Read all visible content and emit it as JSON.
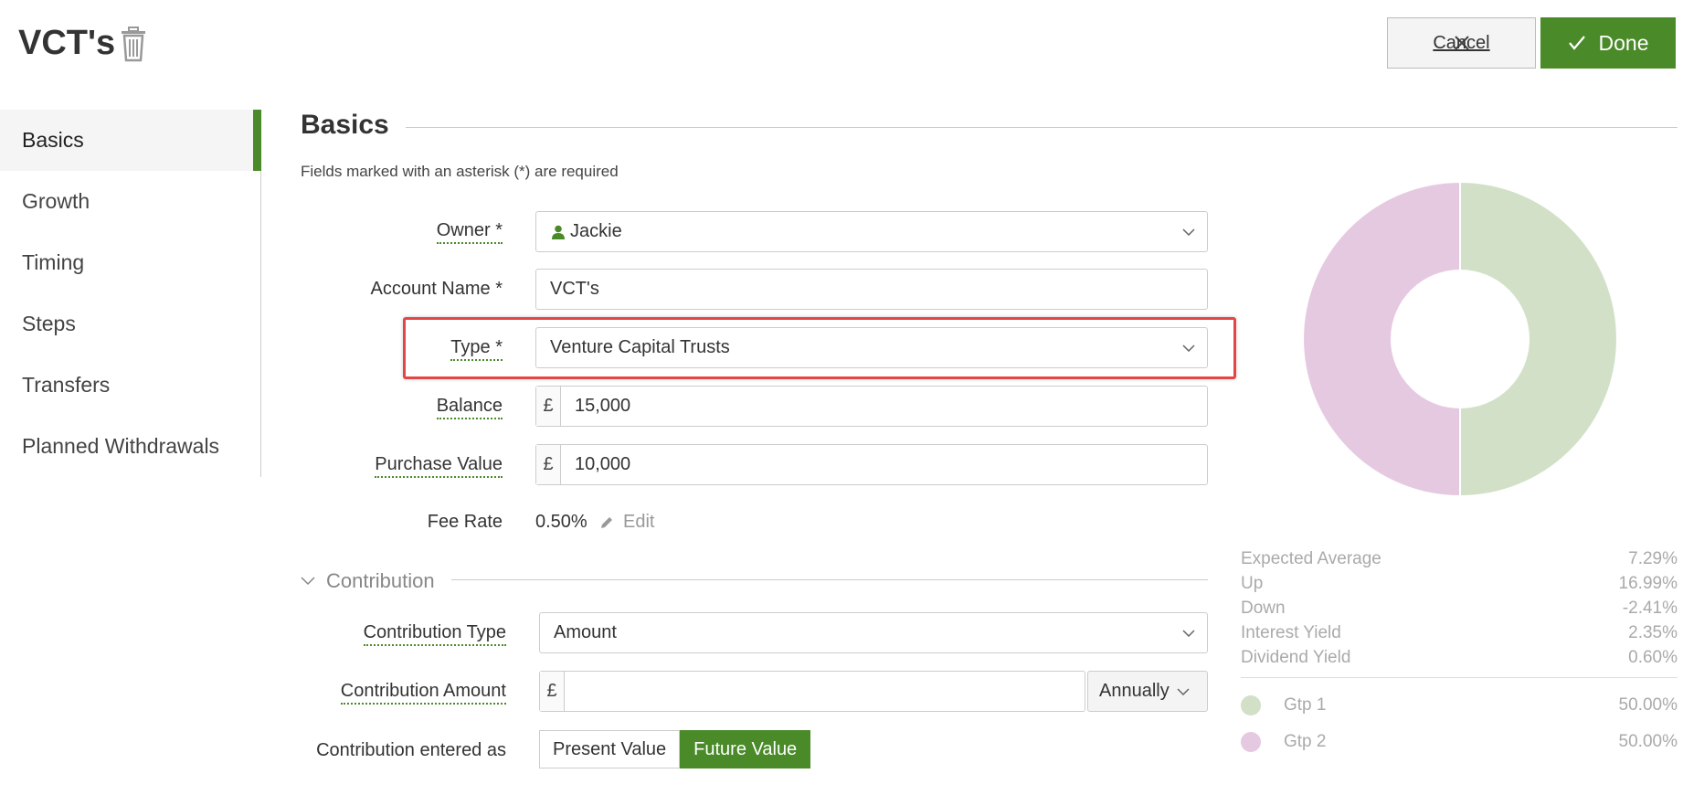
{
  "page": {
    "title": "VCT's",
    "cancel_label": "Cancel",
    "done_label": "Done"
  },
  "sidebar": {
    "items": [
      {
        "label": "Basics",
        "active": true
      },
      {
        "label": "Growth"
      },
      {
        "label": "Timing"
      },
      {
        "label": "Steps"
      },
      {
        "label": "Transfers"
      },
      {
        "label": "Planned Withdrawals"
      }
    ]
  },
  "basics": {
    "section_title": "Basics",
    "required_note": "Fields marked with an asterisk (*) are required",
    "owner": {
      "label": "Owner *",
      "value": "Jackie"
    },
    "account_name": {
      "label": "Account Name *",
      "value": "VCT's"
    },
    "type": {
      "label": "Type *",
      "value": "Venture Capital Trusts"
    },
    "balance": {
      "label": "Balance",
      "currency": "£",
      "value": "15,000"
    },
    "purchase_value": {
      "label": "Purchase Value",
      "currency": "£",
      "value": "10,000"
    },
    "fee_rate": {
      "label": "Fee Rate",
      "value": "0.50%",
      "edit_label": "Edit"
    }
  },
  "contribution": {
    "heading": "Contribution",
    "type": {
      "label": "Contribution Type",
      "value": "Amount"
    },
    "amount": {
      "label": "Contribution Amount",
      "currency": "£",
      "value": "",
      "frequency": "Annually"
    },
    "entered_as": {
      "label": "Contribution entered as",
      "options": [
        "Present Value",
        "Future Value"
      ],
      "selected": "Future Value"
    }
  },
  "stats": {
    "rows": [
      {
        "label": "Expected Average",
        "value": "7.29%"
      },
      {
        "label": "Up",
        "value": "16.99%"
      },
      {
        "label": "Down",
        "value": "-2.41%"
      },
      {
        "label": "Interest Yield",
        "value": "2.35%"
      },
      {
        "label": "Dividend Yield",
        "value": "0.60%"
      }
    ],
    "legend": [
      {
        "label": "Gtp 1",
        "value": "50.00%",
        "color": "#d2e0c7"
      },
      {
        "label": "Gtp 2",
        "value": "50.00%",
        "color": "#e5c9e1"
      }
    ]
  },
  "chart_data": {
    "type": "pie",
    "categories": [
      "Gtp 1",
      "Gtp 2"
    ],
    "values": [
      50.0,
      50.0
    ],
    "colors": [
      "#d2e0c7",
      "#e5c9e1"
    ]
  },
  "colors": {
    "accent": "#4a8a28",
    "highlight": "#e34646"
  }
}
